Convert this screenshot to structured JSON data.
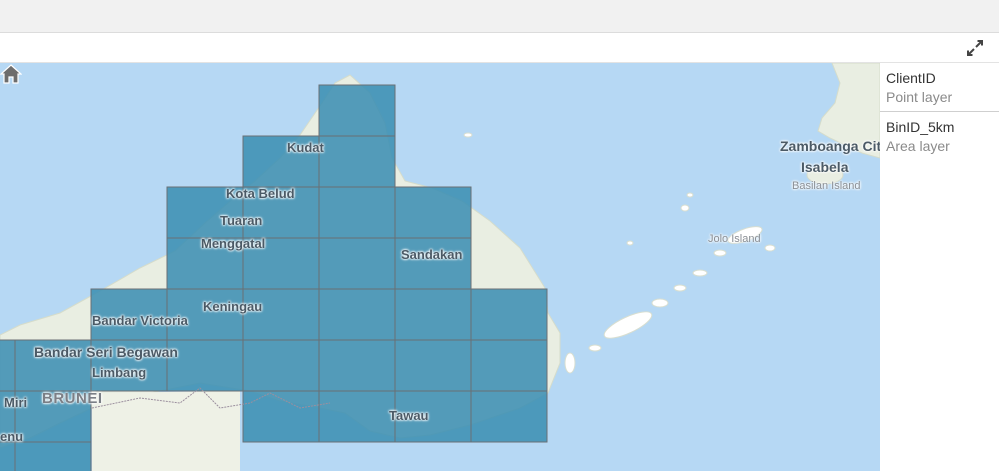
{
  "map": {
    "labels": {
      "kudat": "Kudat",
      "kota_belud": "Kota Belud",
      "tuaran": "Tuaran",
      "menggatal": "Menggatal",
      "sandakan": "Sandakan",
      "keningau": "Keningau",
      "bandar_victoria": "Bandar Victoria",
      "bandar_seri_begawan": "Bandar Seri Begawan",
      "limbang": "Limbang",
      "miri": "Miri",
      "brunei": "BRUNEI",
      "enu": "enu",
      "tawau": "Tawau",
      "zamboanga": "Zamboanga Cit",
      "isabela": "Isabela",
      "basilan": "Basilan Island",
      "jolo": "Jolo Island"
    },
    "colors": {
      "water": "#b6d8f4",
      "land": "#e9eee2",
      "bin_fill": "#3d8fb3",
      "bin_stroke": "#6a6f74"
    }
  },
  "legend": {
    "layers": [
      {
        "name": "ClientID",
        "type": "Point layer"
      },
      {
        "name": "BinID_5km",
        "type": "Area layer"
      }
    ]
  },
  "icons": {
    "expand": "expand-arrows-icon",
    "home": "home-icon"
  }
}
